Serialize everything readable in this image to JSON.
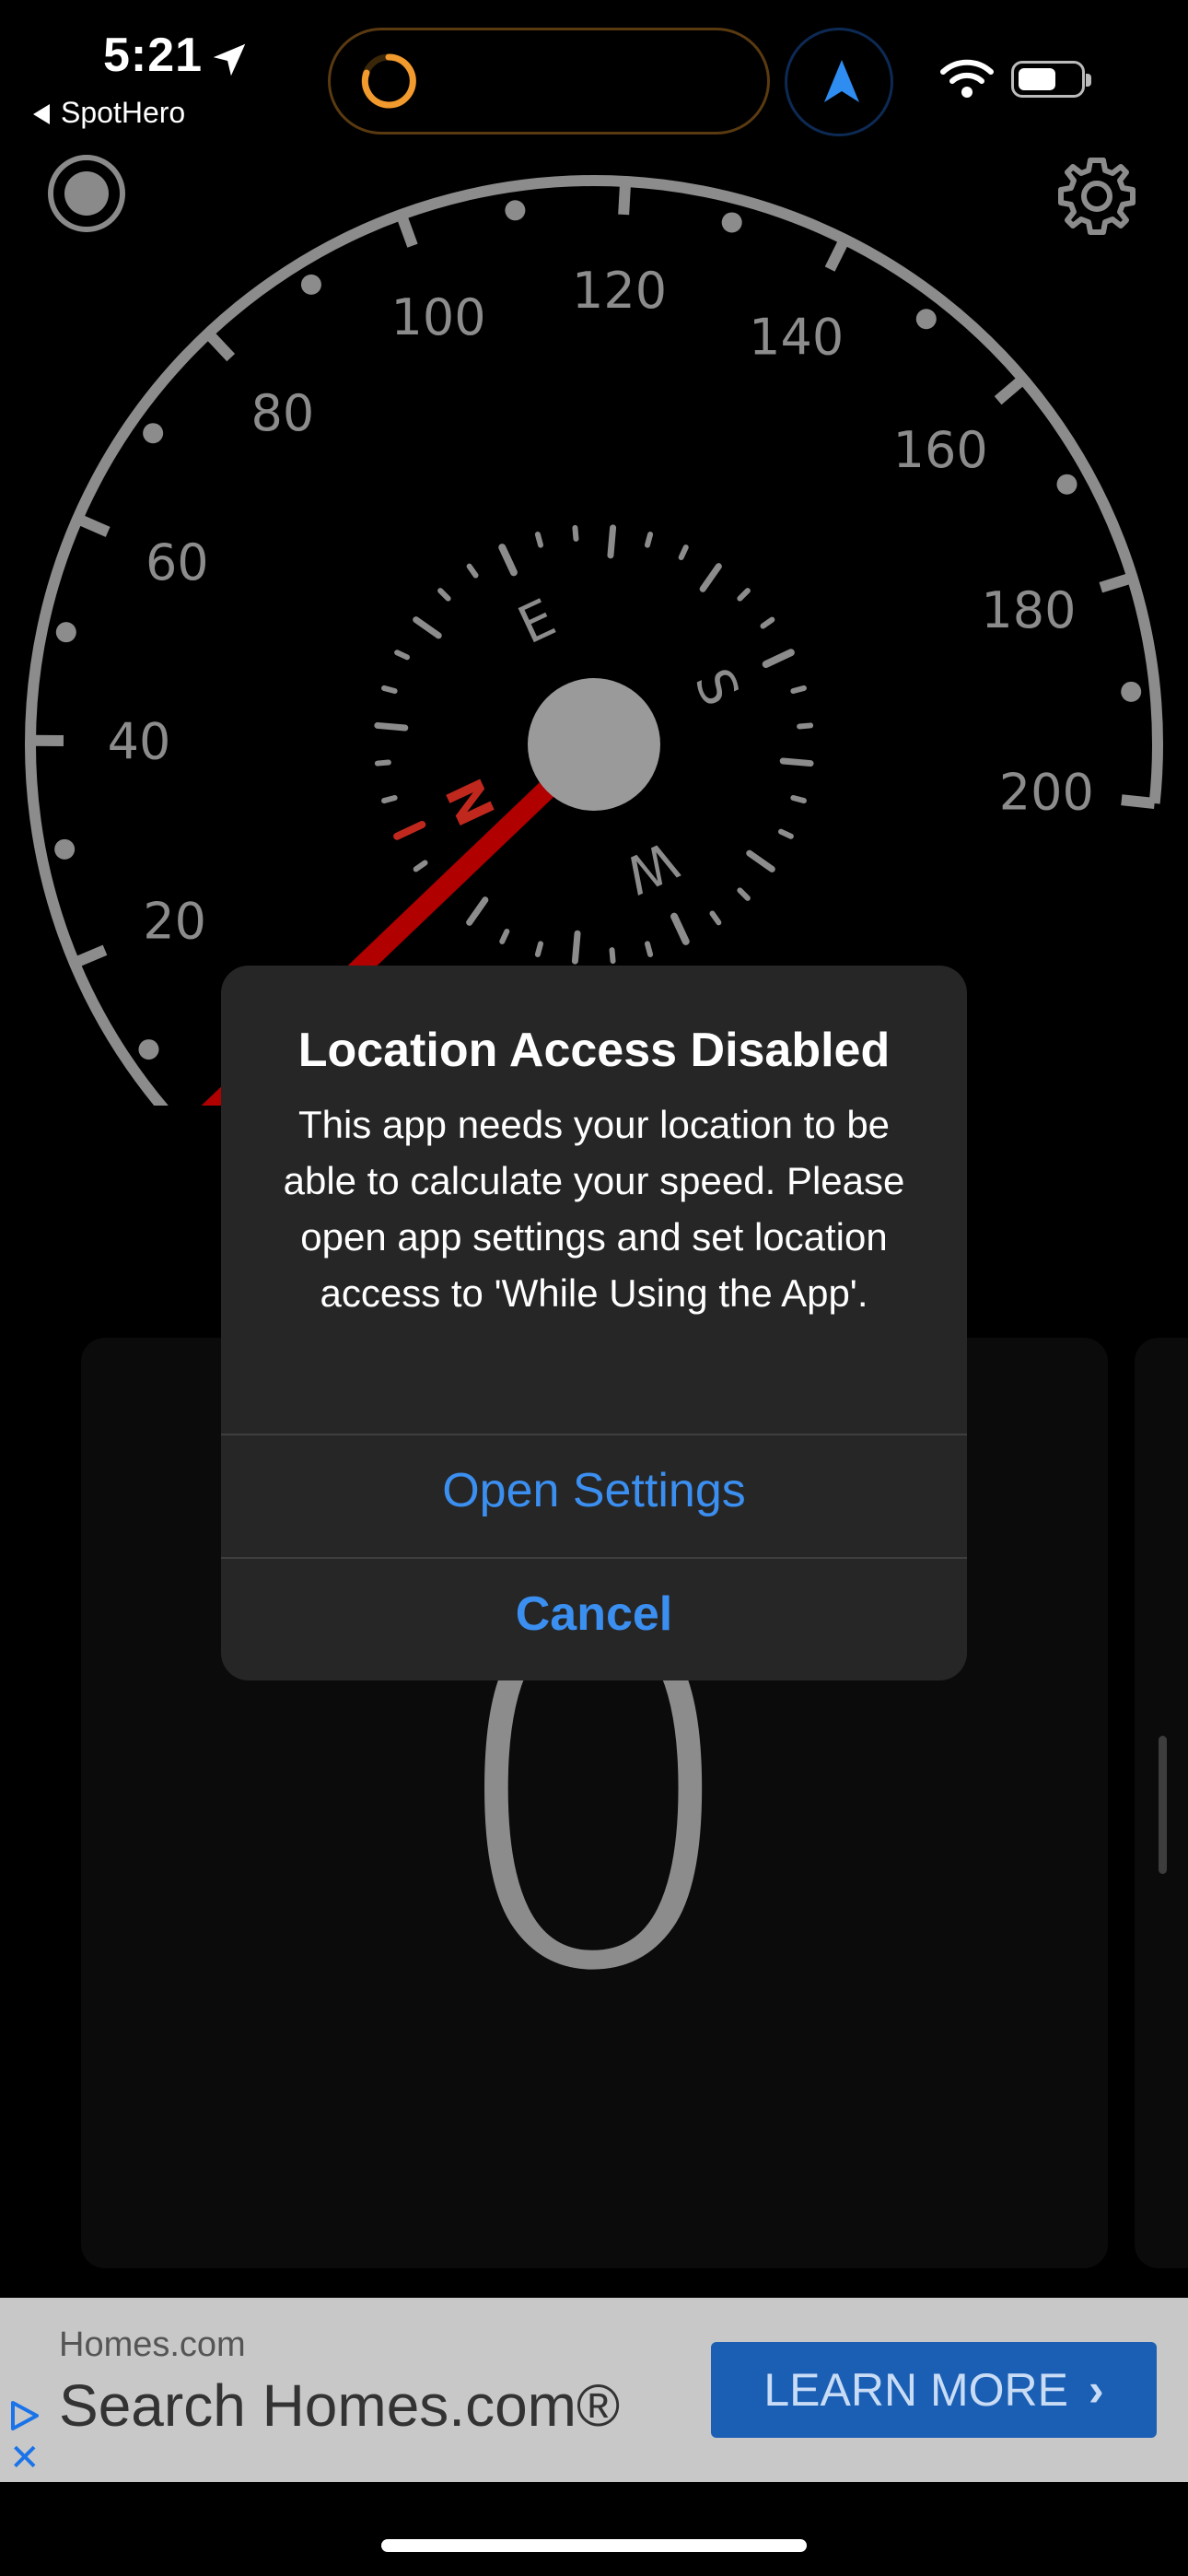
{
  "status_bar": {
    "time": "5:21",
    "back_app": "SpotHero"
  },
  "gauge": {
    "speed_labels": [
      "20",
      "40",
      "60",
      "80",
      "100",
      "120",
      "140",
      "160",
      "180",
      "200"
    ],
    "compass": {
      "north": "N",
      "east": "E",
      "south": "S",
      "west": "W"
    },
    "needle_color": "#b00000"
  },
  "speed_display": {
    "value": "0"
  },
  "alert": {
    "title": "Location Access Disabled",
    "message": "This app needs your location to be able to calculate your speed. Please open app settings and set location access to 'While Using the App'.",
    "primary_button": "Open Settings",
    "cancel_button": "Cancel"
  },
  "ad": {
    "brand": "Homes.com",
    "headline": "Search Homes.com®",
    "cta": "LEARN MORE"
  },
  "colors": {
    "accent": "#3b8ff0",
    "gauge_gray": "#8c8c8c",
    "cta_blue": "#1a5fb4"
  }
}
